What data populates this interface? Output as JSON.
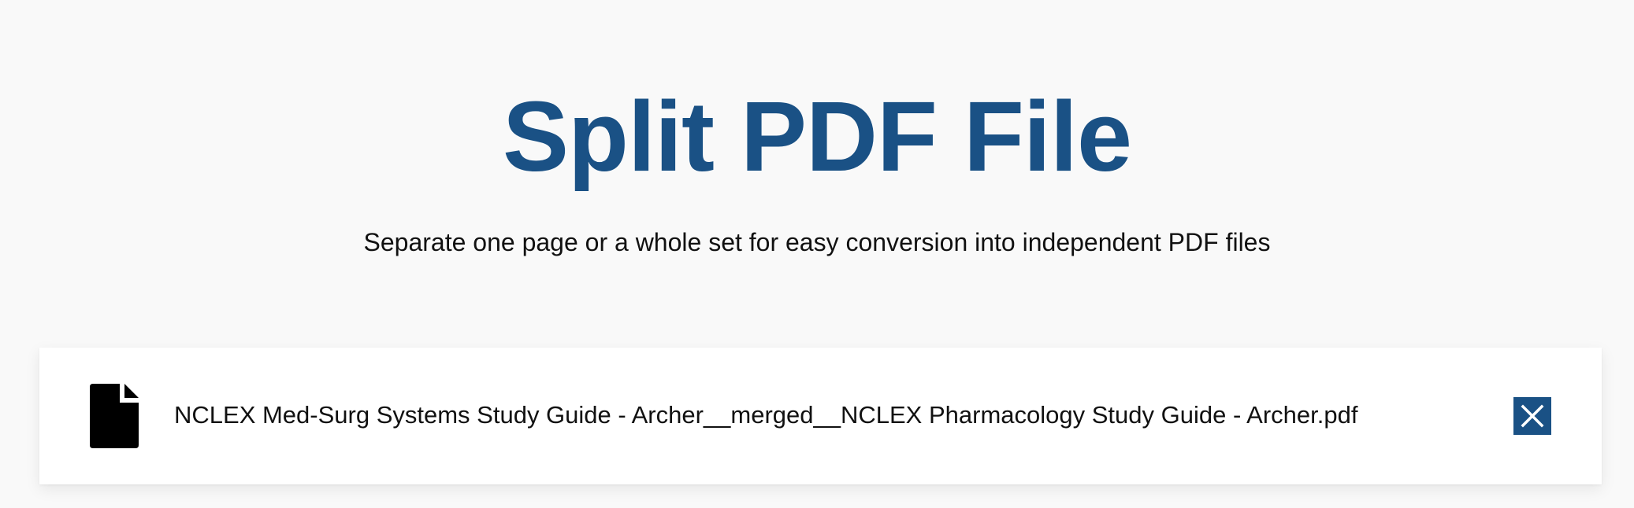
{
  "header": {
    "title": "Split PDF File",
    "subtitle": "Separate one page or a whole set for easy conversion into independent PDF files"
  },
  "file": {
    "icon": "document-icon",
    "name": "NCLEX Med-Surg Systems Study Guide - Archer__merged__NCLEX Pharmacology Study Guide - Archer.pdf",
    "remove_icon": "close-icon"
  },
  "colors": {
    "accent": "#1a5185",
    "background": "#f9f9f9",
    "card": "#ffffff",
    "text": "#111111"
  }
}
